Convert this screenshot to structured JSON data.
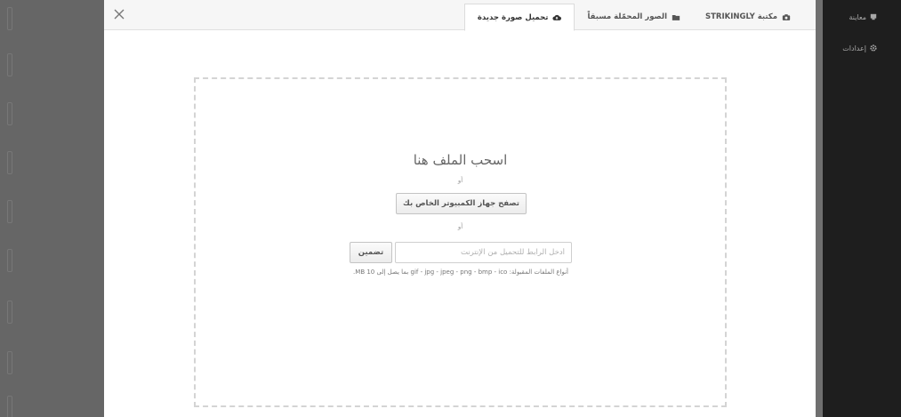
{
  "sidebar": {
    "preview_label": "معاينة",
    "settings_label": "إعدادات"
  },
  "modal": {
    "tabs": [
      {
        "label": "تحميل صورة جديدة",
        "icon": "cloud-upload-icon",
        "active": true
      },
      {
        "label": "الصور المحمّلة مسبقاً",
        "icon": "folder-icon",
        "active": false
      },
      {
        "label": "مكتبة STRIKINGLY",
        "icon": "camera-icon",
        "active": false
      }
    ],
    "drop_title": "اسحب الملف هنا",
    "or_1": "أو",
    "browse_label": "تصفح جهاز الكمبيوتر الخاص بك",
    "or_2": "أو",
    "url_placeholder": "أدخل الرابط للتحميل من الإنترنت",
    "url_value": "",
    "embed_label": "تضمين",
    "file_types": "أنواع الملفات المقبولة: gif - jpg - jpeg - png - bmp - ico بما يصل إلى MB 10."
  },
  "colors": {
    "overlay": "#5b5b5b",
    "sidebar_bg": "#1e1e1e",
    "modal_header": "#f6f6f6",
    "dashed_border": "#d4d4d4"
  }
}
